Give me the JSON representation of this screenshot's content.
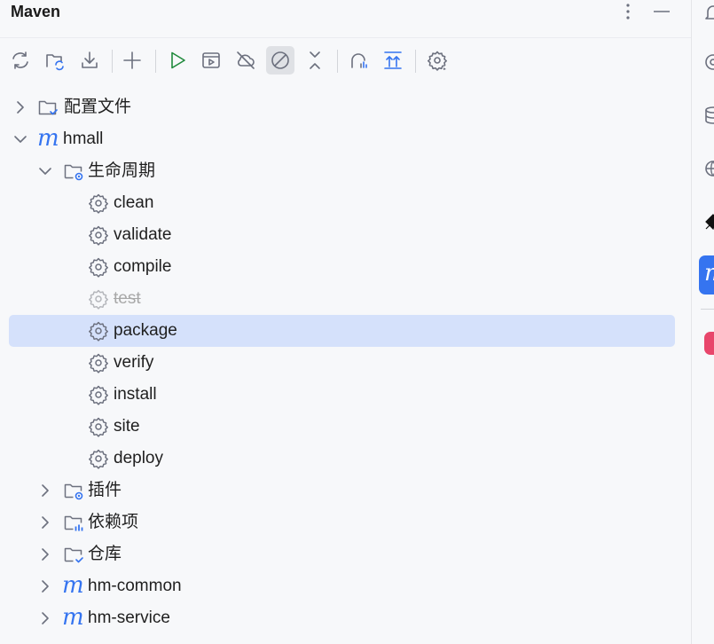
{
  "header": {
    "title": "Maven"
  },
  "toolbar": {
    "items": [
      {
        "name": "reload-all-icon"
      },
      {
        "name": "reload-project-icon"
      },
      {
        "name": "download-sources-icon"
      },
      {
        "name": "add-project-icon"
      },
      {
        "name": "run-goal-icon"
      },
      {
        "name": "execute-goal-icon"
      },
      {
        "name": "offline-mode-icon"
      },
      {
        "name": "skip-tests-icon",
        "active": true
      },
      {
        "name": "collapse-all-icon"
      },
      {
        "name": "show-dependencies-icon"
      },
      {
        "name": "expand-all-icon"
      },
      {
        "name": "settings-icon"
      }
    ]
  },
  "tree": {
    "profiles": "配置文件",
    "project": "hmall",
    "lifecycle": "生命周期",
    "goals": [
      "clean",
      "validate",
      "compile",
      "test",
      "package",
      "verify",
      "install",
      "site",
      "deploy"
    ],
    "disabled_goal": "test",
    "selected_goal": "package",
    "plugins": "插件",
    "dependencies": "依赖项",
    "repositories": "仓库",
    "modules": [
      "hm-common",
      "hm-service"
    ]
  },
  "colors": {
    "accent": "#3574f0",
    "selection": "#d5e1fb",
    "background": "#f7f8fa",
    "icon": "#6c707e",
    "run_green": "#208a3c",
    "sidebar_active": "#3574f0",
    "sidebar_red": "#e8466b"
  }
}
